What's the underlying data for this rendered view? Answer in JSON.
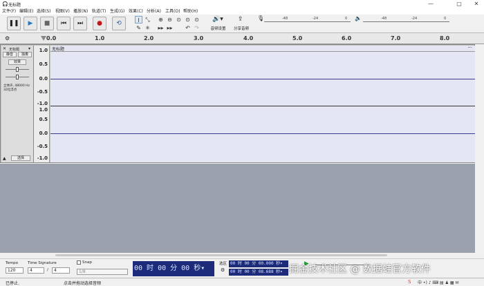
{
  "window": {
    "title": "无标题",
    "minimize": "—",
    "maximize": "▢",
    "close": "✕"
  },
  "menu": [
    "文件(F)",
    "编辑(E)",
    "选择(S)",
    "视图(V)",
    "播放(N)",
    "轨道(T)",
    "生成(G)",
    "效果(C)",
    "分析(A)",
    "工具(O)",
    "帮助(H)"
  ],
  "toolbar": {
    "audio_settings": "音频设置",
    "share_audio": "分享音频",
    "trim_label": "▸▸",
    "silence_label": "▸▸"
  },
  "meters": {
    "rec_scale": [
      "-48",
      "-24",
      "0"
    ],
    "play_scale": [
      "-48",
      "-24",
      "0"
    ]
  },
  "ruler": {
    "ticks": [
      "0.0",
      "1.0",
      "2.0",
      "3.0",
      "4.0",
      "5.0",
      "6.0",
      "7.0",
      "8.0"
    ]
  },
  "track": {
    "name": "无标题",
    "mute": "静音",
    "solo": "独奏",
    "effects": "效果",
    "rate_info": "立体声, 48000 Hz",
    "format_info": "32位浮点",
    "select": "选择",
    "clip_name": "无标题",
    "clip_menu": "···",
    "scale_top": [
      "1.0",
      "0.5",
      "0.0",
      "-0.5",
      "-1.0"
    ],
    "scale_bottom": [
      "1.0",
      "0.5",
      "0.0",
      "-0.5",
      "-1.0"
    ]
  },
  "bottom": {
    "tempo_label": "Tempo",
    "tempo_value": "120",
    "sig_label": "Time Signature",
    "sig_num": "4",
    "sig_slash": "/",
    "sig_den": "4",
    "snap_label": "Snap",
    "snap_value": "1/8",
    "time_display": "00 时 00 分 00 秒▾",
    "selection_label": "选区",
    "sel_start": "00 时 00 分 00.000 秒▾",
    "sel_end": "00 时 00 分 08.688 秒▾"
  },
  "status": {
    "state": "已停止.",
    "hint": "点击并拖动选择音频"
  },
  "watermark": "掘金技术社区 @ 数据蛙官方软件",
  "colors": {
    "time_bg": "#1c2c7a",
    "wave_bg": "#e4e7f3",
    "empty_bg": "#9aa0ac"
  }
}
